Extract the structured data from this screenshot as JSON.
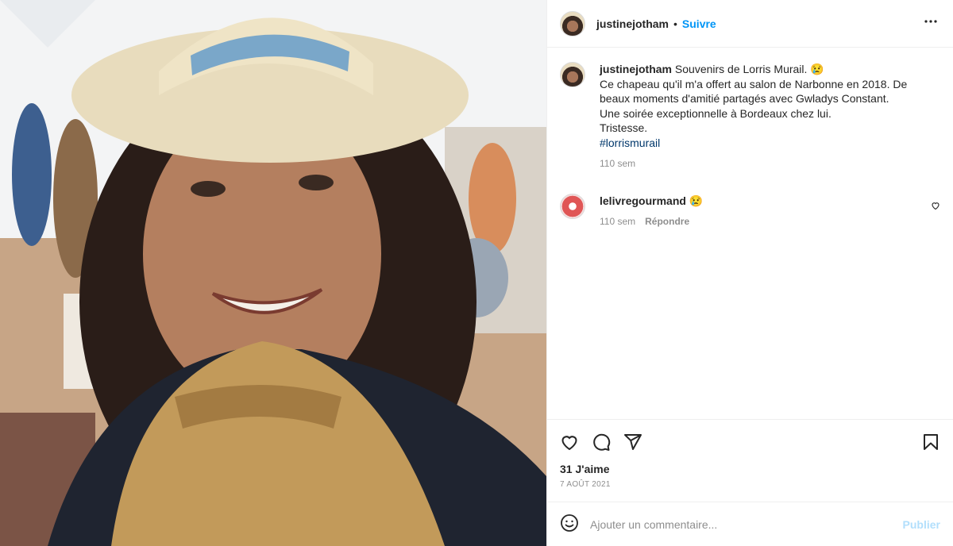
{
  "post": {
    "username": "justinejotham",
    "follow_label": "Suivre",
    "separator": "•",
    "more_label": "•••"
  },
  "caption": {
    "username": "justinejotham",
    "text": "Souvenirs de Lorris Murail. 😢",
    "lines": [
      "Ce chapeau qu'il m'a offert au salon de Narbonne en 2018. De",
      "beaux moments d'amitié partagés avec Gwladys Constant.",
      "Une soirée exceptionnelle à Bordeaux chez lui.",
      "Tristesse."
    ],
    "hashtag": "#lorrismurail",
    "time": "110 sem"
  },
  "comment": {
    "username": "lelivregourmand",
    "text": "😢",
    "time": "110 sem",
    "reply_label": "Répondre"
  },
  "stats": {
    "likes": "31 J'aime",
    "date": "7 AOÛT 2021"
  },
  "add_comment": {
    "placeholder": "Ajouter un commentaire...",
    "publish_label": "Publier"
  },
  "icons": {
    "like": "heart-icon",
    "comment": "comment-bubble-icon",
    "share": "paper-plane-icon",
    "save": "bookmark-icon",
    "emoji": "smiley-icon",
    "more": "ellipsis-icon"
  },
  "colors": {
    "accent": "#0095f6",
    "publish_disabled": "#b2dffc",
    "meta_grey": "#8e8e8e",
    "hashtag": "#00376b"
  }
}
